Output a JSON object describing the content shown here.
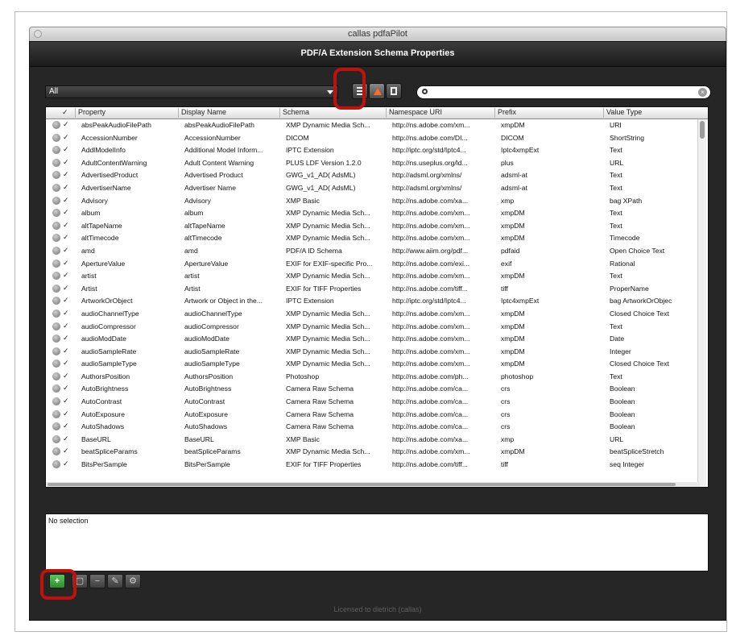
{
  "window": {
    "title": "callas pdfaPilot",
    "header_title": "PDF/A Extension Schema Properties",
    "footer": "Licensed to dietrich (callas)"
  },
  "filter": {
    "value": "All"
  },
  "search": {
    "placeholder": "",
    "value": ""
  },
  "columns": [
    "✓",
    "Property",
    "Display Name",
    "Schema",
    "Namespace URI",
    "Prefix",
    "Value Type"
  ],
  "rows": [
    [
      "absPeakAudioFilePath",
      "absPeakAudioFilePath",
      "XMP Dynamic Media Sch...",
      "http://ns.adobe.com/xm...",
      "xmpDM",
      "URI"
    ],
    [
      "AccessionNumber",
      "AccessionNumber",
      "DICOM",
      "http://ns.adobe.com/DI...",
      "DICOM",
      "ShortString"
    ],
    [
      "AddlModelInfo",
      "Additional Model Inform...",
      "IPTC Extension",
      "http://iptc.org/std/Iptc4...",
      "Iptc4xmpExt",
      "Text"
    ],
    [
      "AdultContentWarning",
      "Adult Content Warning",
      "PLUS LDF Version 1.2.0",
      "http://ns.useplus.org/ld...",
      "plus",
      "URL"
    ],
    [
      "AdvertisedProduct",
      "Advertised Product",
      "GWG_v1_AD( AdsML)",
      "http://adsml.org/xmlns/",
      "adsml-at",
      "Text"
    ],
    [
      "AdvertiserName",
      "Advertiser Name",
      "GWG_v1_AD( AdsML)",
      "http://adsml.org/xmlns/",
      "adsml-at",
      "Text"
    ],
    [
      "Advisory",
      "Advisory",
      "XMP Basic",
      "http://ns.adobe.com/xa...",
      "xmp",
      "bag XPath"
    ],
    [
      "album",
      "album",
      "XMP Dynamic Media Sch...",
      "http://ns.adobe.com/xm...",
      "xmpDM",
      "Text"
    ],
    [
      "altTapeName",
      "altTapeName",
      "XMP Dynamic Media Sch...",
      "http://ns.adobe.com/xm...",
      "xmpDM",
      "Text"
    ],
    [
      "altTimecode",
      "altTimecode",
      "XMP Dynamic Media Sch...",
      "http://ns.adobe.com/xm...",
      "xmpDM",
      "Timecode"
    ],
    [
      "amd",
      "amd",
      "PDF/A ID Schema",
      "http://www.aiim.org/pdf...",
      "pdfaid",
      "Open Choice Text"
    ],
    [
      "ApertureValue",
      "ApertureValue",
      "EXIF for EXIF-specific Pro...",
      "http://ns.adobe.com/exi...",
      "exif",
      "Rational"
    ],
    [
      "artist",
      "artist",
      "XMP Dynamic Media Sch...",
      "http://ns.adobe.com/xm...",
      "xmpDM",
      "Text"
    ],
    [
      "Artist",
      "Artist",
      "EXIF for TIFF Properties",
      "http://ns.adobe.com/tiff...",
      "tiff",
      "ProperName"
    ],
    [
      "ArtworkOrObject",
      "Artwork or Object in the...",
      "IPTC Extension",
      "http://iptc.org/std/Iptc4...",
      "Iptc4xmpExt",
      "bag ArtworkOrObjec"
    ],
    [
      "audioChannelType",
      "audioChannelType",
      "XMP Dynamic Media Sch...",
      "http://ns.adobe.com/xm...",
      "xmpDM",
      "Closed Choice Text"
    ],
    [
      "audioCompressor",
      "audioCompressor",
      "XMP Dynamic Media Sch...",
      "http://ns.adobe.com/xm...",
      "xmpDM",
      "Text"
    ],
    [
      "audioModDate",
      "audioModDate",
      "XMP Dynamic Media Sch...",
      "http://ns.adobe.com/xm...",
      "xmpDM",
      "Date"
    ],
    [
      "audioSampleRate",
      "audioSampleRate",
      "XMP Dynamic Media Sch...",
      "http://ns.adobe.com/xm...",
      "xmpDM",
      "Integer"
    ],
    [
      "audioSampleType",
      "audioSampleType",
      "XMP Dynamic Media Sch...",
      "http://ns.adobe.com/xm...",
      "xmpDM",
      "Closed Choice Text"
    ],
    [
      "AuthorsPosition",
      "AuthorsPosition",
      "Photoshop",
      "http://ns.adobe.com/ph...",
      "photoshop",
      "Text"
    ],
    [
      "AutoBrightness",
      "AutoBrightness",
      "Camera Raw Schema",
      "http://ns.adobe.com/ca...",
      "crs",
      "Boolean"
    ],
    [
      "AutoContrast",
      "AutoContrast",
      "Camera Raw Schema",
      "http://ns.adobe.com/ca...",
      "crs",
      "Boolean"
    ],
    [
      "AutoExposure",
      "AutoExposure",
      "Camera Raw Schema",
      "http://ns.adobe.com/ca...",
      "crs",
      "Boolean"
    ],
    [
      "AutoShadows",
      "AutoShadows",
      "Camera Raw Schema",
      "http://ns.adobe.com/ca...",
      "crs",
      "Boolean"
    ],
    [
      "BaseURL",
      "BaseURL",
      "XMP Basic",
      "http://ns.adobe.com/xa...",
      "xmp",
      "URL"
    ],
    [
      "beatSpliceParams",
      "beatSpliceParams",
      "XMP Dynamic Media Sch...",
      "http://ns.adobe.com/xm...",
      "xmpDM",
      "beatSpliceStretch"
    ],
    [
      "BitsPerSample",
      "BitsPerSample",
      "EXIF for TIFF Properties",
      "http://ns.adobe.com/tiff...",
      "tiff",
      "seq Integer"
    ]
  ],
  "description": {
    "text": "No selection"
  },
  "toolbar": {
    "add_label": "+",
    "remove_label": "−"
  },
  "colors": {
    "highlight": "#c1110d",
    "window_bg": "#262626",
    "add_green": "#2c8d2a",
    "sort_orange": "#ff6a2a"
  }
}
